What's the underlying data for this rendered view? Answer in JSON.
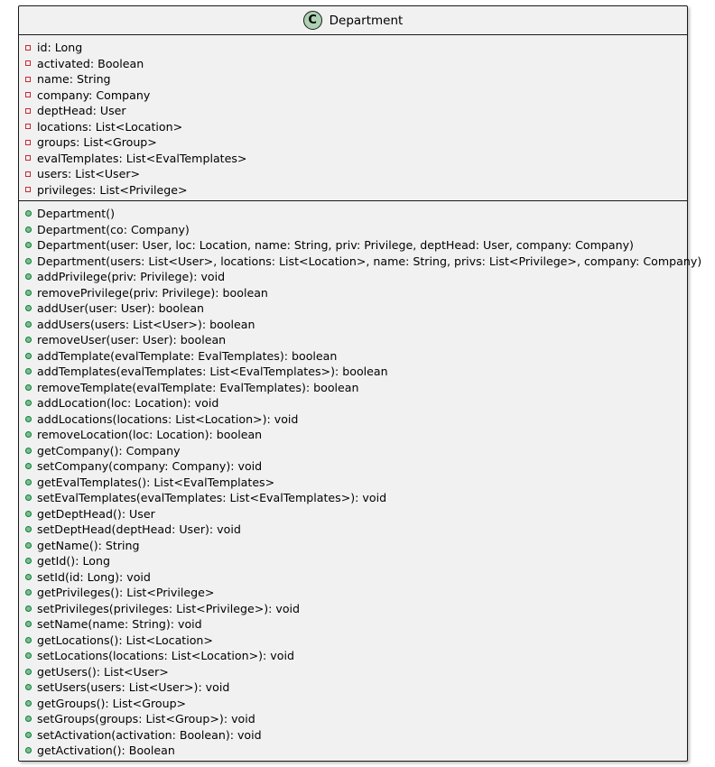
{
  "class": {
    "stereotype_letter": "C",
    "name": "Department"
  },
  "fields": [
    "id: Long",
    "activated: Boolean",
    "name: String",
    "company: Company",
    "deptHead: User",
    "locations: List<Location>",
    "groups: List<Group>",
    "evalTemplates: List<EvalTemplates>",
    "users: List<User>",
    "privileges: List<Privilege>"
  ],
  "methods": [
    "Department()",
    "Department(co: Company)",
    "Department(user: User, loc: Location, name: String, priv: Privilege, deptHead: User, company: Company)",
    "Department(users: List<User>, locations: List<Location>, name: String, privs: List<Privilege>, company: Company)",
    "addPrivilege(priv: Privilege): void",
    "removePrivilege(priv: Privilege): boolean",
    "addUser(user: User): boolean",
    "addUsers(users: List<User>): boolean",
    "removeUser(user: User): boolean",
    "addTemplate(evalTemplate: EvalTemplates): boolean",
    "addTemplates(evalTemplates: List<EvalTemplates>): boolean",
    "removeTemplate(evalTemplate: EvalTemplates): boolean",
    "addLocation(loc: Location): void",
    "addLocations(locations: List<Location>): void",
    "removeLocation(loc: Location): boolean",
    "getCompany(): Company",
    "setCompany(company: Company): void",
    "getEvalTemplates(): List<EvalTemplates>",
    "setEvalTemplates(evalTemplates: List<EvalTemplates>): void",
    "getDeptHead(): User",
    "setDeptHead(deptHead: User): void",
    "getName(): String",
    "getId(): Long",
    "setId(id: Long): void",
    "getPrivileges(): List<Privilege>",
    "setPrivileges(privileges: List<Privilege>): void",
    "setName(name: String): void",
    "getLocations(): List<Location>",
    "setLocations(locations: List<Location>): void",
    "getUsers(): List<User>",
    "setUsers(users: List<User>): void",
    "getGroups(): List<Group>",
    "setGroups(groups: List<Group>): void",
    "setActivation(activation: Boolean): void",
    "getActivation(): Boolean"
  ],
  "colors": {
    "class_background": "#f1f1f1",
    "stereotype_circle": "#add1b2",
    "private_marker": "#c82930",
    "public_marker_fill": "#84be84",
    "public_marker_border": "#038048"
  },
  "icons": {
    "stereotype": "class-stereotype-icon",
    "private": "private-visibility-icon",
    "public": "public-visibility-icon"
  }
}
